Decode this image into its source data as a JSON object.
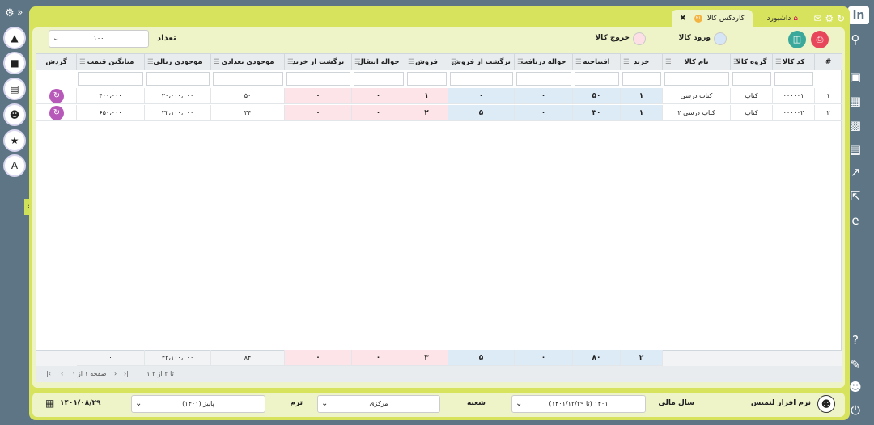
{
  "tabs": {
    "active": "کاردکس کالا",
    "active_badge": "۲۱",
    "dashboard": "داشبورد"
  },
  "toolbar": {
    "count_label": "تعداد",
    "count_value": "۱۰۰",
    "entry_label": "ورود کالا",
    "exit_label": "خروج کالا"
  },
  "columns": [
    "#",
    "کد کالا",
    "گروه کالا",
    "نام کالا",
    "خرید",
    "افتتاحیه",
    "حواله دریافت",
    "برگشت از فروش",
    "فروش",
    "حواله انتقال",
    "برگشت از خرید",
    "موجودی تعدادی",
    "موجودی ریالی",
    "میانگین قیمت",
    "گردش"
  ],
  "rows": [
    [
      "۱",
      "۰۰۰۰۰۱",
      "کتاب",
      "کتاب درسی",
      "۱",
      "۵۰",
      "۰",
      "۰",
      "۱",
      "۰",
      "۰",
      "۵۰",
      "۲۰،۰۰۰،۰۰۰",
      "۴۰۰،۰۰۰"
    ],
    [
      "۲",
      "۰۰۰۰۰۲",
      "کتاب",
      "کتاب درسی ۲",
      "۱",
      "۳۰",
      "۰",
      "۵",
      "۲",
      "۰",
      "۰",
      "۳۴",
      "۲۲،۱۰۰،۰۰۰",
      "۶۵۰،۰۰۰"
    ]
  ],
  "totals": {
    "buy": "۲",
    "opening": "۸۰",
    "recv": "۰",
    "retsale": "۵",
    "sale": "۳",
    "transfer": "۰",
    "retbuy": "۰",
    "qty": "۸۴",
    "amount": "۴۲،۱۰۰،۰۰۰",
    "avg": "۰"
  },
  "pager": {
    "page": "صفحه ۱ از ۱",
    "range": "۱ تا ۲ از ۲"
  },
  "bottom": {
    "user": "نرم افزار لنمیس",
    "fiscal_label": "سال مالی",
    "fiscal_value": "(تا ۱۴۰۱/۱۲/۲۹) ۱۴۰۱",
    "branch_label": "شعبه",
    "branch_value": "مرکزی",
    "term_label": "ترم",
    "term_value": "پاییز (۱۴۰۱)",
    "date": "۱۴۰۱/۰۸/۲۹"
  }
}
